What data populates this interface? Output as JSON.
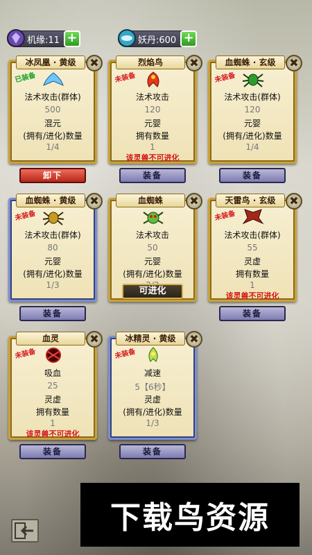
{
  "resources": {
    "luck": {
      "label": "机缘:11",
      "icon": "gem-icon"
    },
    "demon_pill": {
      "label": "妖丹:600",
      "icon": "pill-icon"
    }
  },
  "cards": [
    {
      "title": "冰凤凰 · 黄级",
      "stamp": "已装备",
      "stamp_color": "#17a125",
      "pet": "phoenix",
      "attack": "法术攻击(群体)",
      "value": "500",
      "realm": "混元",
      "count_label": "(拥有/进化)数量",
      "count": "1/4",
      "warning": "",
      "button": "卸下",
      "frame": "gold"
    },
    {
      "title": "烈焰鸟",
      "stamp": "未装备",
      "stamp_color": "#d61a1a",
      "pet": "fire-bird",
      "attack": "法术攻击",
      "value": "120",
      "realm": "元婴",
      "count_label": "拥有数量",
      "count": "1",
      "warning": "该灵兽不可进化",
      "button": "装备",
      "frame": "gold"
    },
    {
      "title": "血蜘蛛 · 玄级",
      "stamp": "未装备",
      "stamp_color": "#d61a1a",
      "pet": "green-spider",
      "attack": "法术攻击(群体)",
      "value": "120",
      "realm": "元婴",
      "count_label": "(拥有/进化)数量",
      "count": "1/4",
      "warning": "",
      "button": "装备",
      "frame": "gold"
    },
    {
      "title": "血蜘蛛 · 黄级",
      "stamp": "未装备",
      "stamp_color": "#d61a1a",
      "pet": "spider",
      "attack": "法术攻击(群体)",
      "value": "80",
      "realm": "元婴",
      "count_label": "(拥有/进化)数量",
      "count": "1/3",
      "warning": "",
      "button": "装备",
      "frame": "blue"
    },
    {
      "title": "血蜘蛛",
      "stamp": "",
      "stamp_color": "#d61a1a",
      "pet": "red-spider",
      "attack": "法术攻击",
      "value": "50",
      "realm": "元婴",
      "count_label": "(拥有/进化)数量",
      "count": "2/2",
      "warning": "",
      "button": "可进化",
      "frame": "gold"
    },
    {
      "title": "天雷鸟 · 玄级",
      "stamp": "未装备",
      "stamp_color": "#d61a1a",
      "pet": "eagle",
      "attack": "法术攻击(群体)",
      "value": "55",
      "realm": "灵虚",
      "count_label": "拥有数量",
      "count": "1",
      "warning": "该灵兽不可进化",
      "button": "装备",
      "frame": "gold"
    },
    {
      "title": "血灵",
      "stamp": "未装备",
      "stamp_color": "#d61a1a",
      "pet": "blood-spirit",
      "attack": "吸血",
      "value": "25",
      "realm": "灵虚",
      "count_label": "拥有数量",
      "count": "1",
      "warning": "该灵兽不可进化",
      "button": "装备",
      "frame": "gold"
    },
    {
      "title": "冰精灵 · 黄级",
      "stamp": "未装备",
      "stamp_color": "#d61a1a",
      "pet": "ice-sprite",
      "attack": "减速",
      "value": "5【6秒】",
      "realm": "灵虚",
      "count_label": "(拥有/进化)数量",
      "count": "1/3",
      "warning": "",
      "button": "装备",
      "frame": "blue"
    }
  ],
  "equip_label": "装备",
  "evolve_label": "可进化",
  "ad_text": "下载鸟资源",
  "back_icon": "exit-icon"
}
